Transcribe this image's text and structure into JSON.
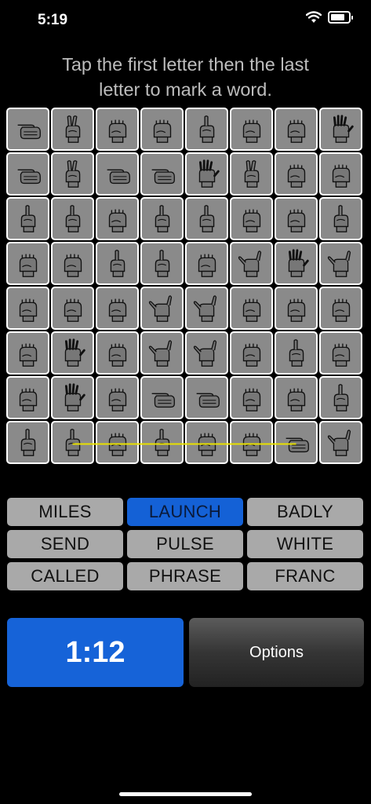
{
  "status": {
    "time": "5:19"
  },
  "instruction": {
    "line1": "Tap the first letter then the last",
    "line2": "letter to mark a word."
  },
  "grid": {
    "rows": 8,
    "cols": 8,
    "selection": {
      "row": 7,
      "from_col": 1,
      "to_col": 6,
      "color": "#e8e000"
    }
  },
  "words": [
    {
      "label": "MILES",
      "active": false
    },
    {
      "label": "LAUNCH",
      "active": true
    },
    {
      "label": "BADLY",
      "active": false
    },
    {
      "label": "SEND",
      "active": false
    },
    {
      "label": "PULSE",
      "active": false
    },
    {
      "label": "WHITE",
      "active": false
    },
    {
      "label": "CALLED",
      "active": false
    },
    {
      "label": "PHRASE",
      "active": false
    },
    {
      "label": "FRANC",
      "active": false
    }
  ],
  "timer": {
    "value": "1:12"
  },
  "options": {
    "label": "Options"
  },
  "colors": {
    "accent": "#1663d8",
    "tile": "#8a8a8a",
    "word_button": "#a9a9a9",
    "selection": "#e8e000"
  },
  "icons": {
    "tile": "hand-sign-icon"
  }
}
